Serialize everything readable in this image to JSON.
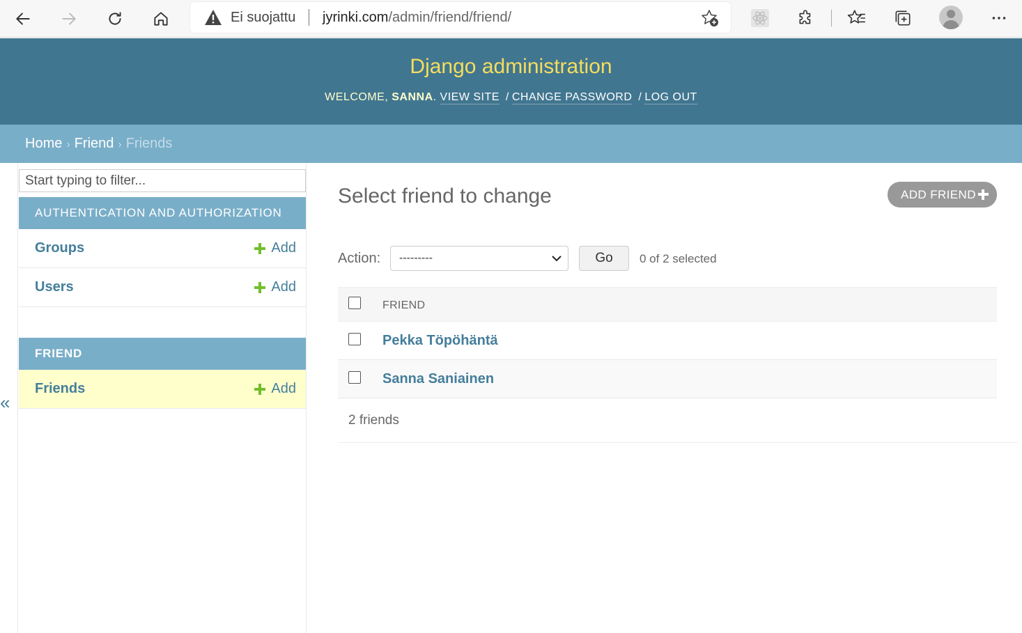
{
  "browser": {
    "not_secure_label": "Ei suojattu",
    "url_host": "jyrinki.com",
    "url_path": "/admin/friend/friend/"
  },
  "header": {
    "site_name": "Django administration",
    "welcome": "WELCOME, ",
    "username": "SANNA",
    "after_username": ".",
    "view_site": "VIEW SITE",
    "change_password": "CHANGE PASSWORD",
    "log_out": "LOG OUT",
    "separator": "/"
  },
  "breadcrumbs": {
    "home": "Home",
    "app": "Friend",
    "current": "Friends",
    "arrow": "›"
  },
  "sidebar": {
    "filter_placeholder": "Start typing to filter...",
    "toggle_label": "«",
    "modules": [
      {
        "caption": "AUTHENTICATION AND AUTHORIZATION",
        "models": [
          {
            "name": "Groups",
            "add_label": "Add"
          },
          {
            "name": "Users",
            "add_label": "Add"
          }
        ]
      },
      {
        "caption": "FRIEND",
        "models": [
          {
            "name": "Friends",
            "add_label": "Add"
          }
        ]
      }
    ]
  },
  "content": {
    "title": "Select friend to change",
    "add_button": "ADD FRIEND",
    "action_label": "Action:",
    "action_selected": "---------",
    "go_label": "Go",
    "selected_count": "0 of 2 selected",
    "column_header": "FRIEND",
    "rows": [
      {
        "name": "Pekka Töpöhäntä"
      },
      {
        "name": "Sanna Saniainen"
      }
    ],
    "paginator": "2 friends"
  },
  "colors": {
    "header_bg": "#417690",
    "site_name": "#f5dd5d",
    "breadcrumb_bg": "#79aec8",
    "link": "#447e9b",
    "add_icon": "#70bf2b",
    "current_model_bg": "#ffffcc"
  }
}
